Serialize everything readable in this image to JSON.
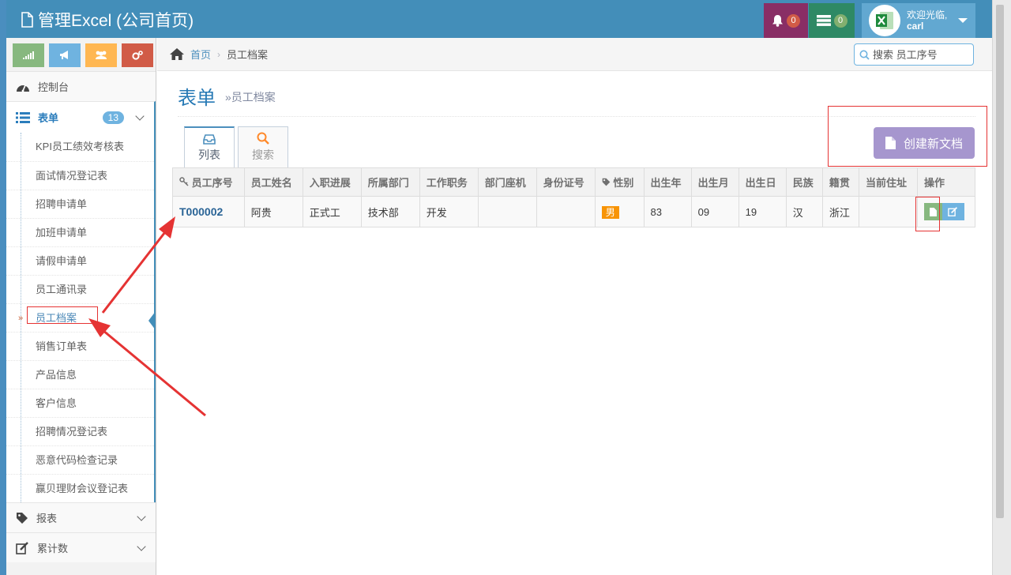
{
  "app": {
    "title": "管理Excel (公司首页)"
  },
  "navbar": {
    "notifications_count": "0",
    "tasks_count": "0",
    "user_greeting": "欢迎光临,",
    "user_name": "carl"
  },
  "sidebar": {
    "dashboard_label": "控制台",
    "forms_label": "表单",
    "forms_count": "13",
    "forms_items": [
      "KPI员工绩效考核表",
      "面试情况登记表",
      "招聘申请单",
      "加班申请单",
      "请假申请单",
      "员工通讯录",
      "员工档案",
      "销售订单表",
      "产品信息",
      "客户信息",
      "招聘情况登记表",
      "恶意代码检查记录",
      "赢贝理财会议登记表"
    ],
    "reports_label": "报表",
    "counter_label": "累计数"
  },
  "breadcrumb": {
    "home": "首页",
    "current": "员工档案"
  },
  "search": {
    "placeholder": "搜索 员工序号"
  },
  "page": {
    "title": "表单",
    "subtitle": "»员工档案"
  },
  "tabs": {
    "list": "列表",
    "search": "搜索"
  },
  "create_button": "创建新文档",
  "table": {
    "headers": [
      "员工序号",
      "员工姓名",
      "入职进展",
      "所属部门",
      "工作职务",
      "部门座机",
      "身份证号",
      "性别",
      "出生年",
      "出生月",
      "出生日",
      "民族",
      "籍贯",
      "当前住址",
      "操作"
    ],
    "rows": [
      {
        "id": "T000002",
        "name": "阿贵",
        "status": "正式工",
        "dept": "技术部",
        "job": "开发",
        "phone": "",
        "idcard": "",
        "gender": "男",
        "year": "83",
        "month": "09",
        "day": "19",
        "ethnic": "汉",
        "origin": "浙江",
        "address": ""
      }
    ]
  },
  "colors": {
    "navbar": "#438eb9",
    "create_button": "#a696ce",
    "annotation": "#e53333"
  }
}
